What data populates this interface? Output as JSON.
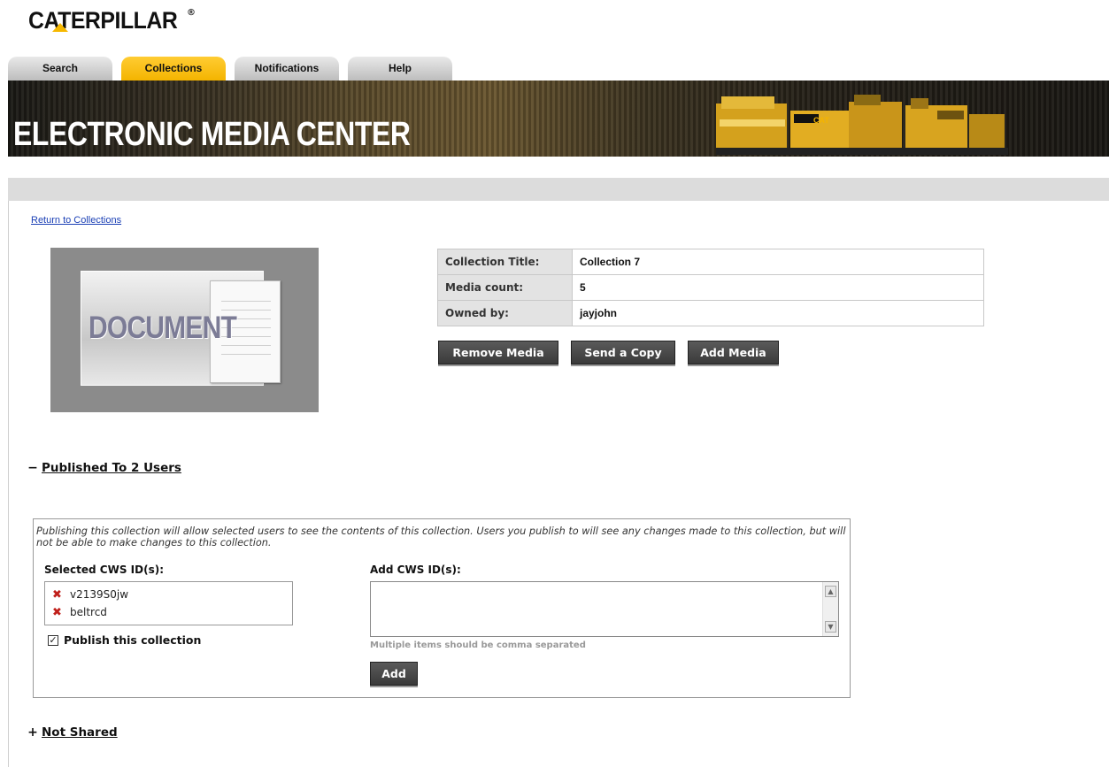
{
  "brand": {
    "logo_text": "CATERPILLAR",
    "logo_mark": "®",
    "accent": "#f4b400"
  },
  "nav": {
    "tabs": [
      {
        "label": "Search",
        "active": false
      },
      {
        "label": "Collections",
        "active": true
      },
      {
        "label": "Notifications",
        "active": false
      },
      {
        "label": "Help",
        "active": false
      }
    ]
  },
  "banner": {
    "title": "ELECTRONIC MEDIA CENTER"
  },
  "return_link": "Return to Collections",
  "thumbnail": {
    "label": "DOCUMENT"
  },
  "collection": {
    "rows": [
      {
        "key": "Collection Title:",
        "value": "Collection 7"
      },
      {
        "key": "Media count:",
        "value": "5"
      },
      {
        "key": "Owned by:",
        "value": "jayjohn"
      }
    ]
  },
  "actions": {
    "remove": "Remove Media",
    "send": "Send a Copy",
    "add": "Add Media"
  },
  "published": {
    "toggle_symbol": "−",
    "header": "Published To 2 Users",
    "description": "Publishing this collection will allow selected users to see the contents of this collection. Users you publish to will see any changes made to this collection, but will not be able to make changes to this collection.",
    "selected_label": "Selected CWS ID(s):",
    "selected_ids": [
      "v2139S0jw",
      "beltrcd"
    ],
    "publish_checkbox_label": "Publish this collection",
    "publish_checked": true,
    "add_label": "Add CWS ID(s):",
    "add_value": "",
    "hint": "Multiple items should be comma separated",
    "add_button": "Add"
  },
  "not_shared": {
    "toggle_symbol": "+",
    "header": "Not Shared"
  }
}
